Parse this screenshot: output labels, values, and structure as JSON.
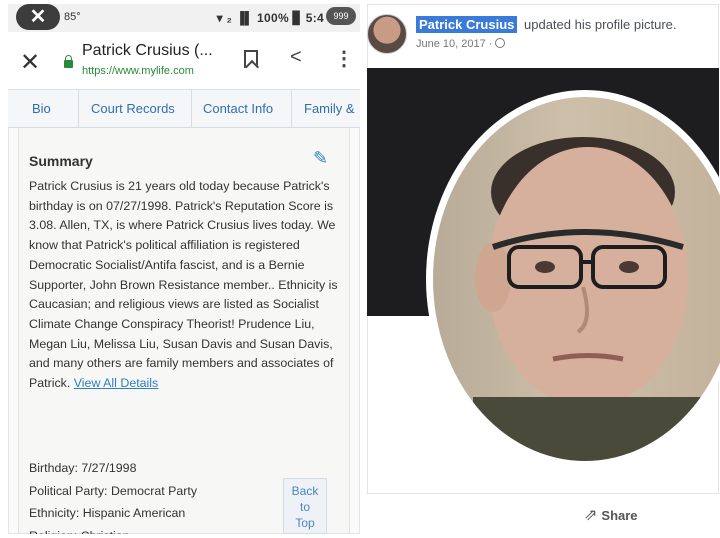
{
  "status_bar": {
    "close_glyph": "✕",
    "temperature": "85°",
    "right_text": "▾ ₂ ▐▌ 100% ▊ 5:4",
    "overflow_badge": "999"
  },
  "browser": {
    "close_glyph": "✕",
    "page_title": "Patrick Crusius (...",
    "url": "https://www.mylife.com",
    "share_glyph": "<",
    "menu_glyph": "⋮"
  },
  "tabs": [
    {
      "label": "Bio"
    },
    {
      "label": "Court Records"
    },
    {
      "label": "Contact Info"
    },
    {
      "label": "Family &"
    }
  ],
  "summary": {
    "title": "Summary",
    "edit_glyph": "✎",
    "text": "Patrick Crusius is 21 years old today because Patrick's birthday is on 07/27/1998. Patrick's Reputation Score is 3.08. Allen, TX, is where Patrick Crusius lives today. We know that Patrick's political affiliation is registered Democratic Socialist/Antifa fascist, and is a Bernie Supporter, John Brown Resistance member.. Ethnicity is Caucasian; and religious views are listed as Socialist Climate Change Conspiracy Theorist! Prudence Liu, Megan Liu, Melissa Liu, Susan Davis and Susan Davis, and many others are family members and associates of Patrick.",
    "link": "View All Details"
  },
  "details": [
    {
      "text": "Birthday: 7/27/1998"
    },
    {
      "text": "Political Party: Democrat Party"
    },
    {
      "text": "Ethnicity: Hispanic American"
    },
    {
      "text": "Religion: Christian"
    }
  ],
  "back_to_top": {
    "line1": "Back",
    "line2": "to",
    "line3": "Top"
  },
  "facebook": {
    "name": "Patrick Crusius",
    "action": "updated his profile picture.",
    "date": "June 10, 2017 ·",
    "share_label": "Share",
    "share_glyph": "⇗"
  }
}
